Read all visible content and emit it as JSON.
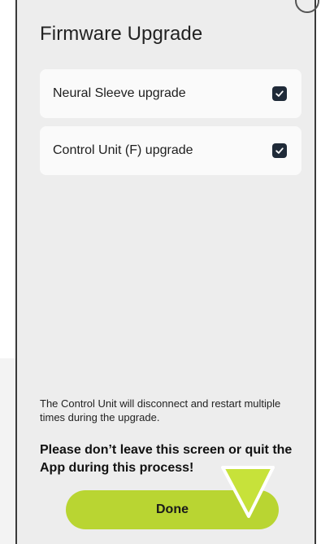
{
  "screen": {
    "title": "Firmware Upgrade"
  },
  "upgrades": [
    {
      "label": "Neural Sleeve upgrade",
      "checked": true
    },
    {
      "label": "Control Unit (F) upgrade",
      "checked": true
    }
  ],
  "notice": "The Control Unit will disconnect and restart multiple times during the upgrade.",
  "warning": "Please don’t leave this screen or quit the App during this process!",
  "actions": {
    "done_label": "Done"
  },
  "colors": {
    "accent": "#b9d532",
    "checkbox": "#1f2a38",
    "background": "#ededed",
    "card": "#fafafa",
    "pointer": "#c7e23a"
  },
  "icons": {
    "checkbox": "check-icon",
    "pointer": "pointer-arrow-icon"
  }
}
